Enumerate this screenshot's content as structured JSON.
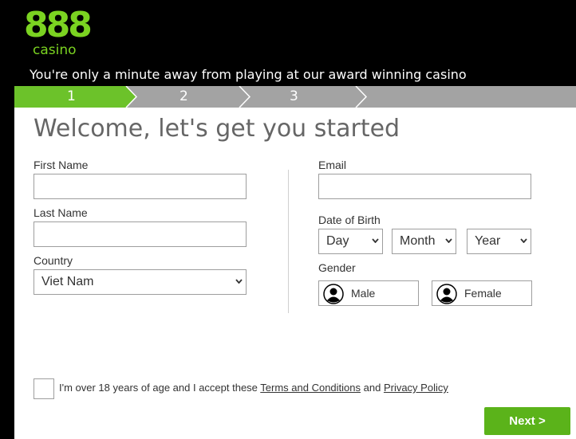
{
  "brand": {
    "logo_number": "888",
    "logo_word": "casino",
    "accent_color": "#7bd321"
  },
  "header": {
    "tagline": "You're only a minute away from playing at our award winning casino"
  },
  "steps": {
    "items": [
      "1",
      "2",
      "3"
    ],
    "active_index": 0,
    "active_color": "#6cc22a",
    "inactive_color": "#a3a3a3"
  },
  "form": {
    "title": "Welcome, let's get you started",
    "first_name": {
      "label": "First Name",
      "value": ""
    },
    "last_name": {
      "label": "Last Name",
      "value": ""
    },
    "country": {
      "label": "Country",
      "value": "Viet Nam"
    },
    "email": {
      "label": "Email",
      "value": ""
    },
    "dob": {
      "label": "Date of Birth",
      "day": "Day",
      "month": "Month",
      "year": "Year"
    },
    "gender": {
      "label": "Gender",
      "male": "Male",
      "female": "Female",
      "icon": "person-icon"
    },
    "terms": {
      "prefix": "I'm over 18 years of age and I accept these ",
      "terms_link": "Terms and Conditions",
      "middle": " and ",
      "privacy_link": "Privacy Policy",
      "checked": false
    },
    "next_label": "Next >",
    "next_color": "#5bb31a"
  }
}
